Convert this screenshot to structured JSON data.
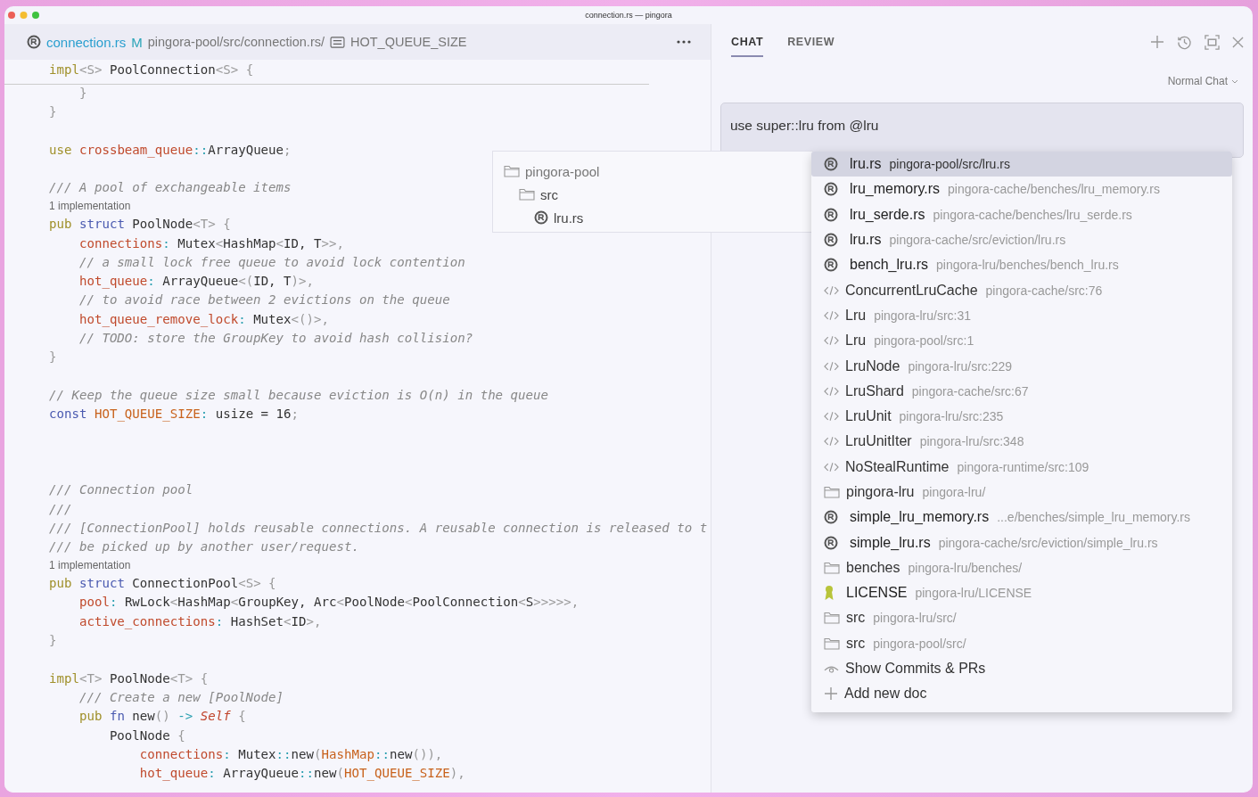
{
  "window": {
    "title": "connection.rs — pingora"
  },
  "editor": {
    "breadcrumb": {
      "file": "connection.rs",
      "status": "M",
      "path": "pingora-pool/src/connection.rs/",
      "symbol": "HOT_QUEUE_SIZE"
    },
    "sticky_line": [
      {
        "text": "impl",
        "kind": "k"
      },
      {
        "text": "<S>",
        "kind": "g"
      },
      {
        "text": " PoolConnection",
        "kind": "n"
      },
      {
        "text": "<S>",
        "kind": "g"
      },
      {
        "text": " {",
        "kind": "g"
      }
    ],
    "lines": [
      {
        "kind": "code",
        "tokens": [
          {
            "text": "    }",
            "kind": "g"
          }
        ]
      },
      {
        "kind": "code",
        "tokens": [
          {
            "text": "}",
            "kind": "g"
          }
        ]
      },
      {
        "kind": "blank"
      },
      {
        "kind": "code",
        "tokens": [
          {
            "text": "use",
            "kind": "k"
          },
          {
            "text": " crossbeam_queue",
            "kind": "f"
          },
          {
            "text": "::",
            "kind": "p"
          },
          {
            "text": "ArrayQueue",
            "kind": "n"
          },
          {
            "text": ";",
            "kind": "g"
          }
        ]
      },
      {
        "kind": "blank"
      },
      {
        "kind": "code",
        "tokens": [
          {
            "text": "/// A pool of exchangeable items",
            "kind": "c"
          }
        ]
      },
      {
        "kind": "hint",
        "text": "1 implementation"
      },
      {
        "kind": "code",
        "tokens": [
          {
            "text": "pub",
            "kind": "k"
          },
          {
            "text": " struct",
            "kind": "b"
          },
          {
            "text": " PoolNode",
            "kind": "n"
          },
          {
            "text": "<T>",
            "kind": "g"
          },
          {
            "text": " {",
            "kind": "g"
          }
        ]
      },
      {
        "kind": "code",
        "tokens": [
          {
            "text": "    connections",
            "kind": "f"
          },
          {
            "text": ":",
            "kind": "p"
          },
          {
            "text": " Mutex",
            "kind": "n"
          },
          {
            "text": "<",
            "kind": "g"
          },
          {
            "text": "HashMap",
            "kind": "n"
          },
          {
            "text": "<",
            "kind": "g"
          },
          {
            "text": "ID, T",
            "kind": "n"
          },
          {
            "text": ">>,",
            "kind": "g"
          }
        ]
      },
      {
        "kind": "code",
        "tokens": [
          {
            "text": "    // a small lock free queue to avoid lock contention",
            "kind": "c"
          }
        ]
      },
      {
        "kind": "code",
        "tokens": [
          {
            "text": "    hot_queue",
            "kind": "f"
          },
          {
            "text": ":",
            "kind": "p"
          },
          {
            "text": " ArrayQueue",
            "kind": "n"
          },
          {
            "text": "<(",
            "kind": "g"
          },
          {
            "text": "ID, T",
            "kind": "n"
          },
          {
            "text": ")>,",
            "kind": "g"
          }
        ]
      },
      {
        "kind": "code",
        "tokens": [
          {
            "text": "    // to avoid race between 2 evictions on the queue",
            "kind": "c"
          }
        ]
      },
      {
        "kind": "code",
        "tokens": [
          {
            "text": "    hot_queue_remove_lock",
            "kind": "f"
          },
          {
            "text": ":",
            "kind": "p"
          },
          {
            "text": " Mutex",
            "kind": "n"
          },
          {
            "text": "<()>,",
            "kind": "g"
          }
        ]
      },
      {
        "kind": "code",
        "tokens": [
          {
            "text": "    // TODO: store the GroupKey to avoid hash collision?",
            "kind": "c"
          }
        ]
      },
      {
        "kind": "code",
        "tokens": [
          {
            "text": "}",
            "kind": "g"
          }
        ]
      },
      {
        "kind": "blank"
      },
      {
        "kind": "code",
        "tokens": [
          {
            "text": "// Keep the queue size small because eviction is O(n) in the queue",
            "kind": "c"
          }
        ]
      },
      {
        "kind": "code",
        "tokens": [
          {
            "text": "const",
            "kind": "b"
          },
          {
            "text": " HOT_QUEUE_SIZE",
            "kind": "o"
          },
          {
            "text": ":",
            "kind": "p"
          },
          {
            "text": " usize = 16",
            "kind": "n"
          },
          {
            "text": ";",
            "kind": "g"
          }
        ]
      },
      {
        "kind": "blank"
      },
      {
        "kind": "blank"
      },
      {
        "kind": "blank"
      },
      {
        "kind": "code",
        "tokens": [
          {
            "text": "/// Connection pool",
            "kind": "c"
          }
        ]
      },
      {
        "kind": "code",
        "tokens": [
          {
            "text": "///",
            "kind": "c"
          }
        ]
      },
      {
        "kind": "code",
        "tokens": [
          {
            "text": "/// [ConnectionPool] holds reusable connections. A reusable connection is released to t",
            "kind": "c"
          }
        ]
      },
      {
        "kind": "code",
        "tokens": [
          {
            "text": "/// be picked up by another user/request.",
            "kind": "c"
          }
        ]
      },
      {
        "kind": "hint",
        "text": "1 implementation"
      },
      {
        "kind": "code",
        "tokens": [
          {
            "text": "pub",
            "kind": "k"
          },
          {
            "text": " struct",
            "kind": "b"
          },
          {
            "text": " ConnectionPool",
            "kind": "n"
          },
          {
            "text": "<S>",
            "kind": "g"
          },
          {
            "text": " {",
            "kind": "g"
          }
        ]
      },
      {
        "kind": "code",
        "tokens": [
          {
            "text": "    pool",
            "kind": "f"
          },
          {
            "text": ":",
            "kind": "p"
          },
          {
            "text": " RwLock",
            "kind": "n"
          },
          {
            "text": "<",
            "kind": "g"
          },
          {
            "text": "HashMap",
            "kind": "n"
          },
          {
            "text": "<",
            "kind": "g"
          },
          {
            "text": "GroupKey, Arc",
            "kind": "n"
          },
          {
            "text": "<",
            "kind": "g"
          },
          {
            "text": "PoolNode",
            "kind": "n"
          },
          {
            "text": "<",
            "kind": "g"
          },
          {
            "text": "PoolConnection",
            "kind": "n"
          },
          {
            "text": "<",
            "kind": "g"
          },
          {
            "text": "S",
            "kind": "n"
          },
          {
            "text": ">>>>>,",
            "kind": "g"
          }
        ]
      },
      {
        "kind": "code",
        "tokens": [
          {
            "text": "    active_connections",
            "kind": "f"
          },
          {
            "text": ":",
            "kind": "p"
          },
          {
            "text": " HashSet",
            "kind": "n"
          },
          {
            "text": "<",
            "kind": "g"
          },
          {
            "text": "ID",
            "kind": "n"
          },
          {
            "text": ">,",
            "kind": "g"
          }
        ]
      },
      {
        "kind": "code",
        "tokens": [
          {
            "text": "}",
            "kind": "g"
          }
        ]
      },
      {
        "kind": "blank"
      },
      {
        "kind": "code",
        "tokens": [
          {
            "text": "impl",
            "kind": "k"
          },
          {
            "text": "<T>",
            "kind": "g"
          },
          {
            "text": " PoolNode",
            "kind": "n"
          },
          {
            "text": "<T>",
            "kind": "g"
          },
          {
            "text": " {",
            "kind": "g"
          }
        ]
      },
      {
        "kind": "code",
        "tokens": [
          {
            "text": "    /// Create a new [PoolNode]",
            "kind": "c"
          }
        ]
      },
      {
        "kind": "code",
        "tokens": [
          {
            "text": "    pub",
            "kind": "k"
          },
          {
            "text": " fn",
            "kind": "b"
          },
          {
            "text": " new",
            "kind": "n"
          },
          {
            "text": "()",
            "kind": "g"
          },
          {
            "text": " ->",
            "kind": "p"
          },
          {
            "text": " Self",
            "kind": "s"
          },
          {
            "text": " {",
            "kind": "g"
          }
        ]
      },
      {
        "kind": "code",
        "tokens": [
          {
            "text": "        PoolNode",
            "kind": "n"
          },
          {
            "text": " {",
            "kind": "g"
          }
        ]
      },
      {
        "kind": "code",
        "tokens": [
          {
            "text": "            connections",
            "kind": "f"
          },
          {
            "text": ":",
            "kind": "p"
          },
          {
            "text": " Mutex",
            "kind": "n"
          },
          {
            "text": "::",
            "kind": "p"
          },
          {
            "text": "new",
            "kind": "n"
          },
          {
            "text": "(",
            "kind": "g"
          },
          {
            "text": "HashMap",
            "kind": "o"
          },
          {
            "text": "::",
            "kind": "p"
          },
          {
            "text": "new",
            "kind": "n"
          },
          {
            "text": "()),",
            "kind": "g"
          }
        ]
      },
      {
        "kind": "code",
        "tokens": [
          {
            "text": "            hot_queue",
            "kind": "f"
          },
          {
            "text": ":",
            "kind": "p"
          },
          {
            "text": " ArrayQueue",
            "kind": "n"
          },
          {
            "text": "::",
            "kind": "p"
          },
          {
            "text": "new",
            "kind": "n"
          },
          {
            "text": "(",
            "kind": "g"
          },
          {
            "text": "HOT_QUEUE_SIZE",
            "kind": "o"
          },
          {
            "text": "),",
            "kind": "g"
          }
        ]
      }
    ]
  },
  "tree_popup": [
    {
      "kind": "folder",
      "label": "pingora-pool",
      "children": [
        {
          "kind": "folder",
          "label": "src",
          "children": [
            {
              "kind": "rust",
              "label": "lru.rs"
            }
          ]
        }
      ]
    }
  ],
  "chat": {
    "tabs": [
      {
        "label": "CHAT",
        "selected": true
      },
      {
        "label": "REVIEW",
        "selected": false
      }
    ],
    "mode": "Normal Chat",
    "input": "use super::lru from @lru",
    "suggestions": [
      {
        "kind": "rust",
        "label": "lru.rs",
        "detail": "pingora-pool/src/lru.rs",
        "selected": true
      },
      {
        "kind": "rust",
        "label": "lru_memory.rs",
        "detail": "pingora-cache/benches/lru_memory.rs",
        "selected": false
      },
      {
        "kind": "rust",
        "label": "lru_serde.rs",
        "detail": "pingora-cache/benches/lru_serde.rs",
        "selected": false
      },
      {
        "kind": "rust",
        "label": "lru.rs",
        "detail": "pingora-cache/src/eviction/lru.rs",
        "selected": false
      },
      {
        "kind": "rust",
        "label": "bench_lru.rs",
        "detail": "pingora-lru/benches/bench_lru.rs",
        "selected": false
      },
      {
        "kind": "symbol",
        "label": "ConcurrentLruCache",
        "detail": "pingora-cache/src:76",
        "selected": false
      },
      {
        "kind": "symbol",
        "label": "Lru",
        "detail": "pingora-lru/src:31",
        "selected": false
      },
      {
        "kind": "symbol",
        "label": "Lru",
        "detail": "pingora-pool/src:1",
        "selected": false
      },
      {
        "kind": "symbol",
        "label": "LruNode",
        "detail": "pingora-lru/src:229",
        "selected": false
      },
      {
        "kind": "symbol",
        "label": "LruShard",
        "detail": "pingora-cache/src:67",
        "selected": false
      },
      {
        "kind": "symbol",
        "label": "LruUnit",
        "detail": "pingora-lru/src:235",
        "selected": false
      },
      {
        "kind": "symbol",
        "label": "LruUnitIter",
        "detail": "pingora-lru/src:348",
        "selected": false
      },
      {
        "kind": "symbol",
        "label": "NoStealRuntime",
        "detail": "pingora-runtime/src:109",
        "selected": false
      },
      {
        "kind": "folder",
        "label": "pingora-lru",
        "detail": "pingora-lru/",
        "selected": false
      },
      {
        "kind": "rust",
        "label": "simple_lru_memory.rs",
        "detail": "...e/benches/simple_lru_memory.rs",
        "selected": false
      },
      {
        "kind": "rust",
        "label": "simple_lru.rs",
        "detail": "pingora-cache/src/eviction/simple_lru.rs",
        "selected": false
      },
      {
        "kind": "folder",
        "label": "benches",
        "detail": "pingora-lru/benches/",
        "selected": false
      },
      {
        "kind": "license",
        "label": "LICENSE",
        "detail": "pingora-lru/LICENSE",
        "selected": false
      },
      {
        "kind": "folder",
        "label": "src",
        "detail": "pingora-lru/src/",
        "selected": false
      },
      {
        "kind": "folder",
        "label": "src",
        "detail": "pingora-pool/src/",
        "selected": false
      },
      {
        "kind": "commits",
        "label": "Show Commits & PRs",
        "selected": false
      },
      {
        "kind": "add",
        "label": "Add new doc",
        "selected": false
      }
    ]
  }
}
